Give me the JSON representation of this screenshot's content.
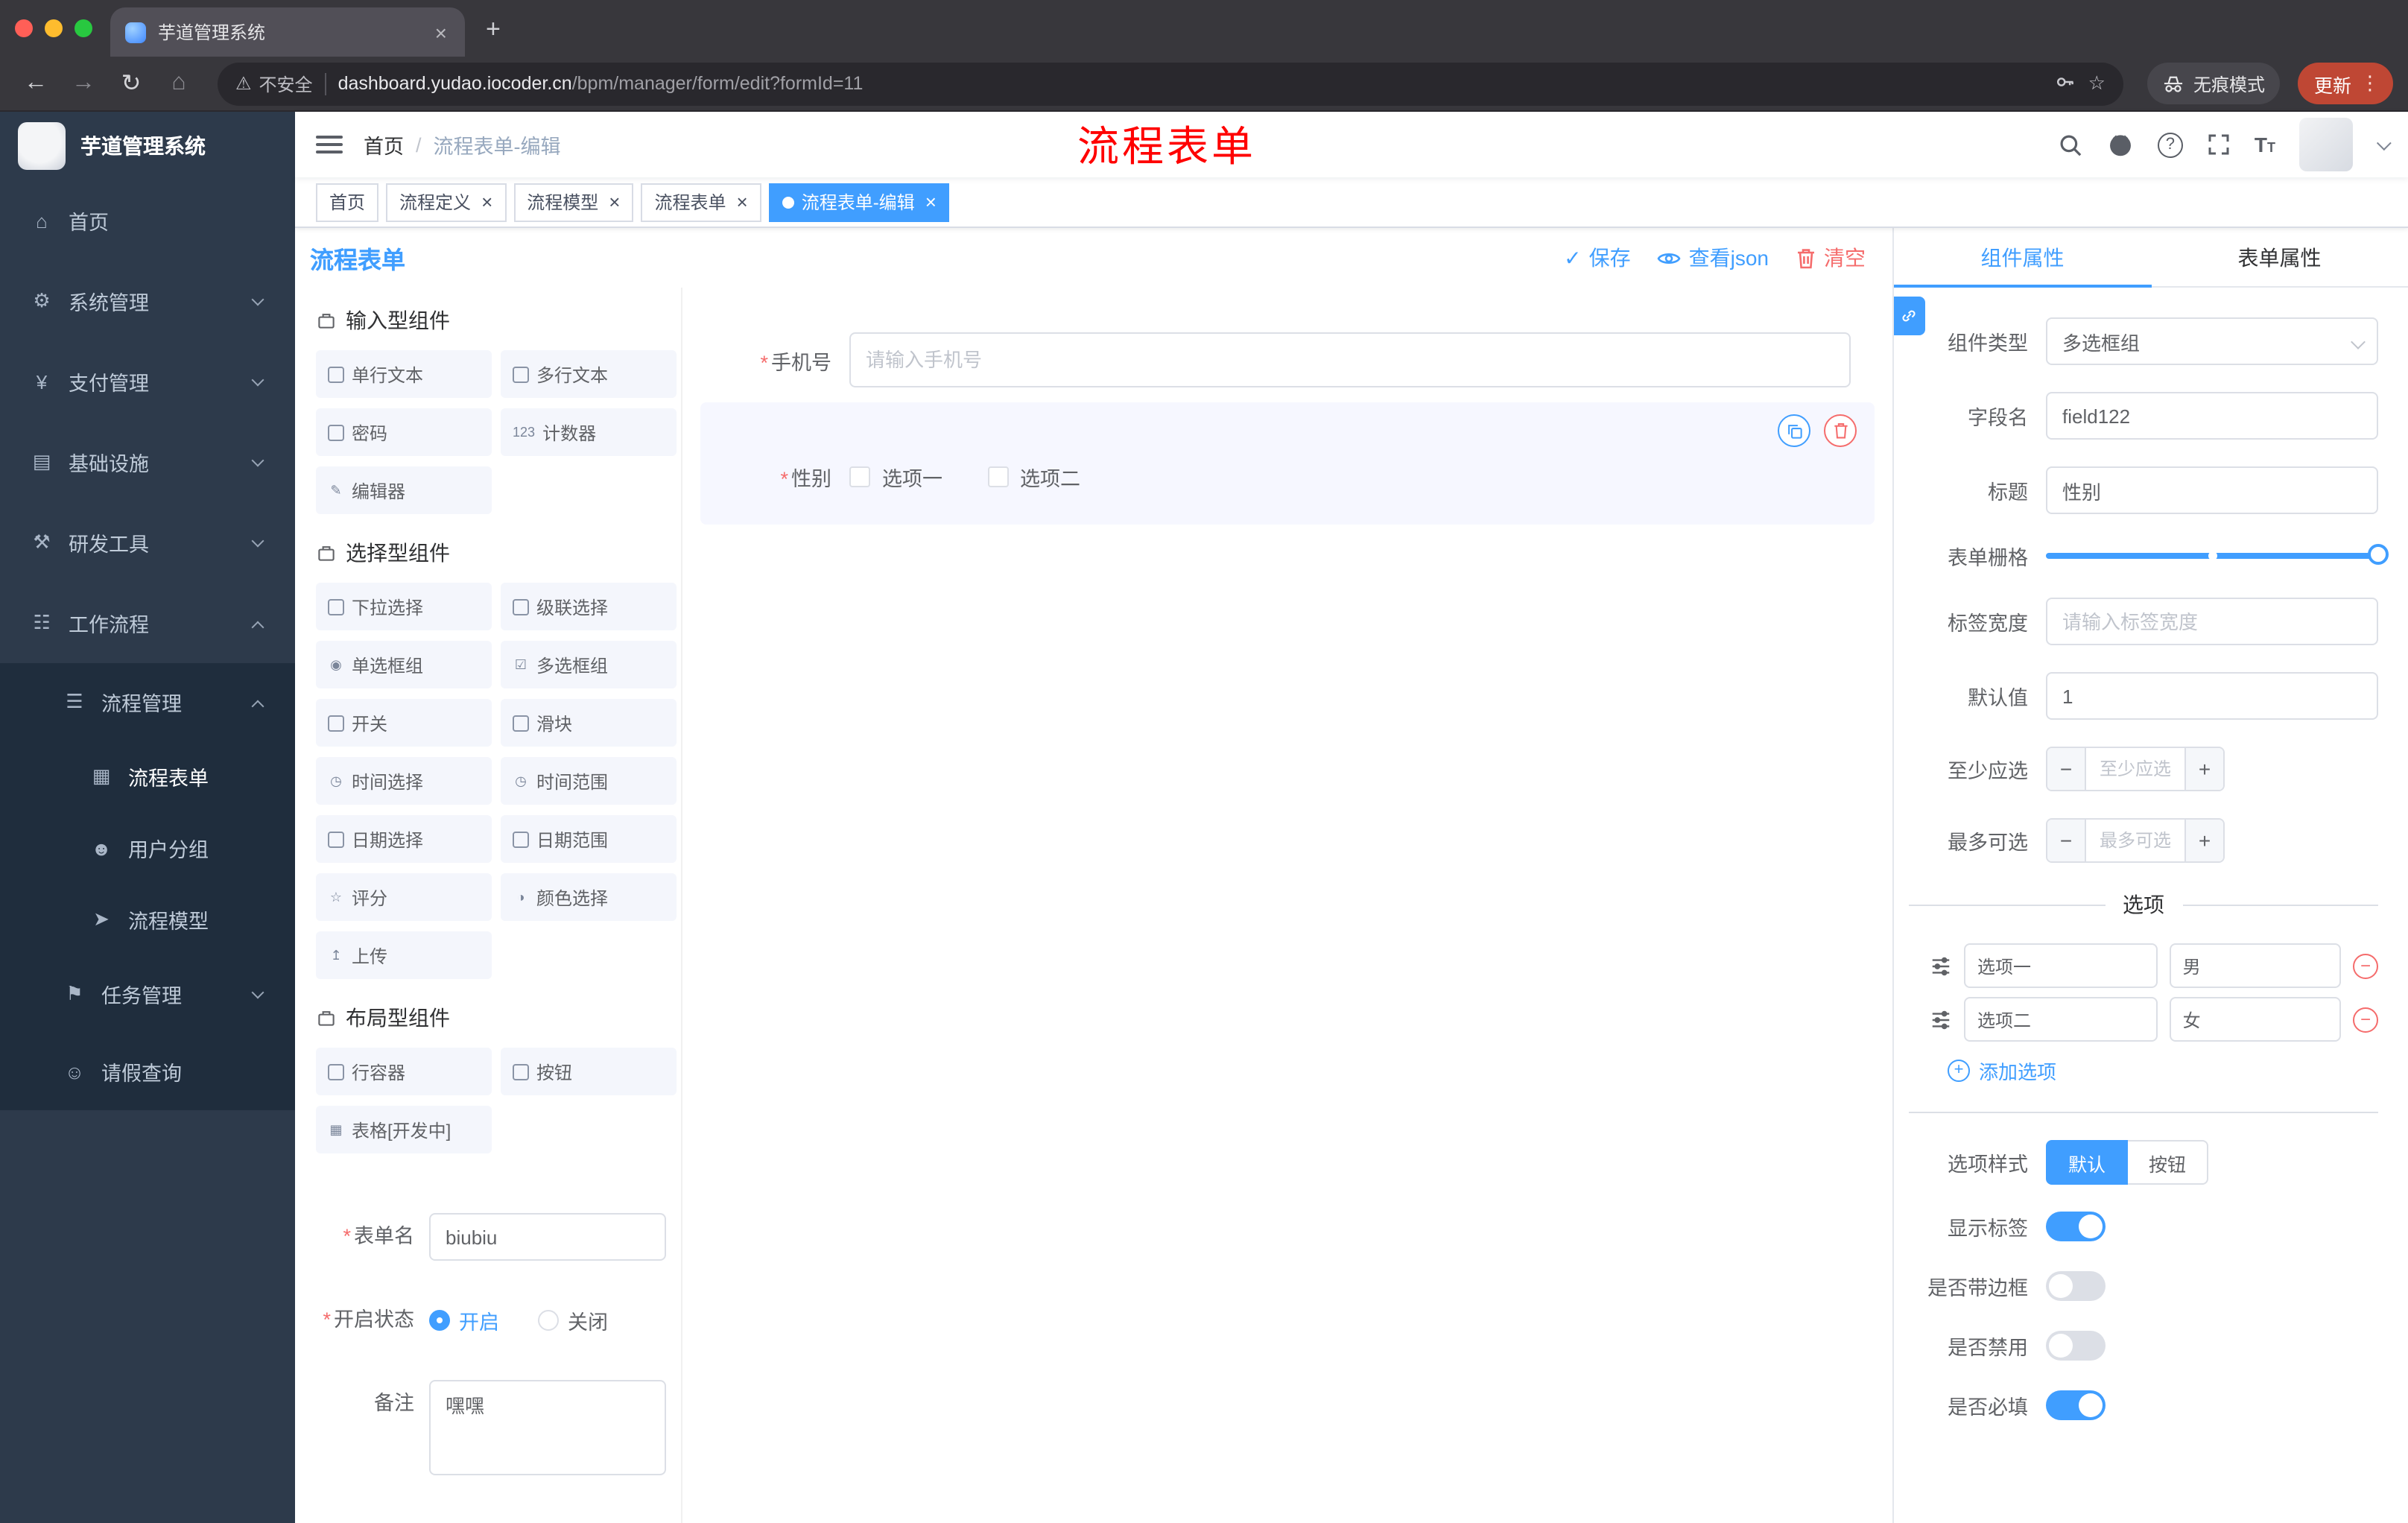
{
  "colors": {
    "primary": "#409eff",
    "danger": "#f56c6c",
    "annotation_red": "#ff0000",
    "active_tag_bg": "#409eff",
    "update_pill_bg": "#bf4734",
    "sidebar_bg": "#2d3a4b",
    "submenu_bg": "#1f2d3d"
  },
  "misc": {
    "required_mark": "*"
  },
  "browser": {
    "tab_title": "芋道管理系统",
    "security_label": "不安全",
    "url_domain": "dashboard.yudao.iocoder.cn",
    "url_path": "/bpm/manager/form/edit?formId=11",
    "incognito_label": "无痕模式",
    "update_label": "更新"
  },
  "sidebar": {
    "logo_title": "芋道管理系统",
    "items": [
      {
        "label": "首页",
        "icon": "home-icon",
        "glyph": "⌂",
        "level": "l1"
      },
      {
        "label": "系统管理",
        "icon": "system-gear-icon",
        "glyph": "⚙",
        "level": "l1",
        "chevron": "down"
      },
      {
        "label": "支付管理",
        "icon": "payment-yen-icon",
        "glyph": "¥",
        "level": "l1",
        "chevron": "down"
      },
      {
        "label": "基础设施",
        "icon": "infrastructure-icon",
        "glyph": "▤",
        "level": "l1",
        "chevron": "down"
      },
      {
        "label": "研发工具",
        "icon": "devtools-icon",
        "glyph": "⚒",
        "level": "l1",
        "chevron": "down"
      },
      {
        "label": "工作流程",
        "icon": "workflow-icon",
        "glyph": "☷",
        "level": "l1",
        "chevron": "up"
      },
      {
        "label": "流程管理",
        "icon": "process-management-icon",
        "glyph": "☰",
        "level": "l2",
        "chevron": "up"
      },
      {
        "label": "流程表单",
        "icon": "process-form-icon",
        "glyph": "▦",
        "level": "l3",
        "active": true
      },
      {
        "label": "用户分组",
        "icon": "user-group-icon",
        "glyph": "☻",
        "level": "l3"
      },
      {
        "label": "流程模型",
        "icon": "process-model-icon",
        "glyph": "➤",
        "level": "l3"
      },
      {
        "label": "任务管理",
        "icon": "task-management-icon",
        "glyph": "⚑",
        "level": "l2",
        "chevron": "down"
      },
      {
        "label": "请假查询",
        "icon": "leave-query-icon",
        "glyph": "☺",
        "level": "l2"
      }
    ]
  },
  "header": {
    "breadcrumb_home": "首页",
    "breadcrumb_sep": "/",
    "breadcrumb_current": "流程表单-编辑",
    "annotation": "流程表单"
  },
  "tags": [
    {
      "label": "首页"
    },
    {
      "label": "流程定义",
      "closable": true
    },
    {
      "label": "流程模型",
      "closable": true
    },
    {
      "label": "流程表单",
      "closable": true
    },
    {
      "label": "流程表单-编辑",
      "closable": true,
      "active": true
    }
  ],
  "designer": {
    "title": "流程表单",
    "save_label": "保存",
    "view_json_label": "查看json",
    "clear_label": "清空",
    "groups": {
      "input": {
        "title": "输入型组件",
        "items": [
          {
            "label": "单行文本",
            "icon": "single-line-text-icon"
          },
          {
            "label": "多行文本",
            "icon": "multi-line-text-icon"
          },
          {
            "label": "密码",
            "icon": "password-lock-icon"
          },
          {
            "label": "计数器",
            "icon": "counter-icon",
            "glyph": "123"
          },
          {
            "label": "编辑器",
            "icon": "editor-icon",
            "glyph": "✎"
          }
        ]
      },
      "select": {
        "title": "选择型组件",
        "items": [
          {
            "label": "下拉选择",
            "icon": "select-dropdown-icon"
          },
          {
            "label": "级联选择",
            "icon": "cascader-icon"
          },
          {
            "label": "单选框组",
            "icon": "radio-group-icon",
            "glyph": "◉"
          },
          {
            "label": "多选框组",
            "icon": "checkbox-group-icon",
            "glyph": "☑"
          },
          {
            "label": "开关",
            "icon": "switch-icon"
          },
          {
            "label": "滑块",
            "icon": "slider-icon"
          },
          {
            "label": "时间选择",
            "icon": "time-picker-icon",
            "glyph": "◷"
          },
          {
            "label": "时间范围",
            "icon": "time-range-icon",
            "glyph": "◷"
          },
          {
            "label": "日期选择",
            "icon": "date-picker-icon"
          },
          {
            "label": "日期范围",
            "icon": "date-range-icon"
          },
          {
            "label": "评分",
            "icon": "rate-star-icon",
            "glyph": "☆"
          },
          {
            "label": "颜色选择",
            "icon": "color-picker-icon",
            "glyph": "◑"
          },
          {
            "label": "上传",
            "icon": "upload-icon",
            "glyph": "↥"
          }
        ]
      },
      "layout": {
        "title": "布局型组件",
        "items": [
          {
            "label": "行容器",
            "icon": "row-container-icon"
          },
          {
            "label": "按钮",
            "icon": "button-icon"
          },
          {
            "label": "表格[开发中]",
            "icon": "table-icon",
            "glyph": "▦"
          }
        ]
      }
    },
    "meta": {
      "name_label": "表单名",
      "name_value": "biubiu",
      "status_label": "开启状态",
      "status_on": "开启",
      "status_off": "关闭",
      "remark_label": "备注",
      "remark_value": "嘿嘿"
    },
    "canvas": {
      "phone_label": "手机号",
      "phone_placeholder": "请输入手机号",
      "gender_label": "性别",
      "gender_option1": "选项一",
      "gender_option2": "选项二"
    }
  },
  "panel": {
    "tab_component": "组件属性",
    "tab_form": "表单属性",
    "component_type_label": "组件类型",
    "component_type_value": "多选框组",
    "field_name_label": "字段名",
    "field_name_value": "field122",
    "title_label": "标题",
    "title_value": "性别",
    "grid_label": "表单栅格",
    "tag_width_label": "标签宽度",
    "tag_width_placeholder": "请输入标签宽度",
    "default_label": "默认值",
    "default_value": "1",
    "min_label": "至少应选",
    "min_placeholder": "至少应选",
    "max_label": "最多可选",
    "max_placeholder": "最多可选",
    "options_divider": "选项",
    "options": [
      {
        "label": "选项一",
        "value": "男"
      },
      {
        "label": "选项二",
        "value": "女"
      }
    ],
    "add_option_label": "添加选项",
    "option_style_label": "选项样式",
    "option_style_default": "默认",
    "option_style_button": "按钮",
    "show_label_label": "显示标签",
    "border_label": "是否带边框",
    "disabled_label": "是否禁用",
    "required_label": "是否必填"
  }
}
